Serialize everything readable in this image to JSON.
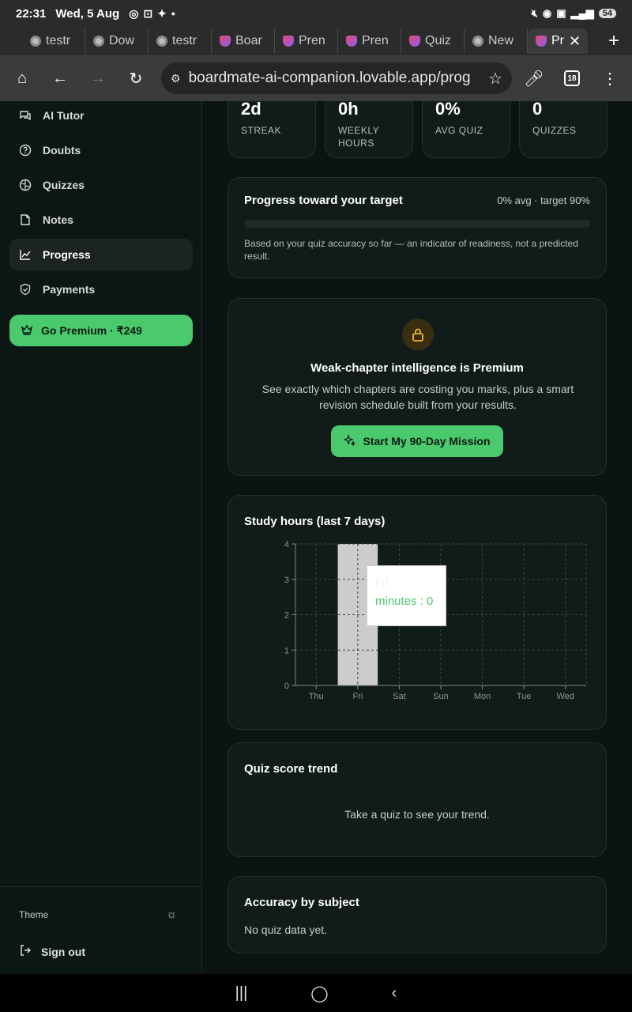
{
  "status": {
    "time": "22:31",
    "date": "Wed, 5 Aug",
    "battery": "54"
  },
  "tabs": [
    {
      "label": "testr",
      "icon": "chrome"
    },
    {
      "label": "Dow",
      "icon": "chrome"
    },
    {
      "label": "testr",
      "icon": "chrome"
    },
    {
      "label": "Boar",
      "icon": "lovable"
    },
    {
      "label": "Pren",
      "icon": "lovable"
    },
    {
      "label": "Pren",
      "icon": "lovable"
    },
    {
      "label": "Quiz",
      "icon": "lovable"
    },
    {
      "label": "New",
      "icon": "chrome"
    },
    {
      "label": "Pr",
      "icon": "lovable",
      "active": true
    }
  ],
  "browser": {
    "url": "boardmate-ai-companion.lovable.app/prog",
    "tab_count": "18"
  },
  "sidebar": {
    "items": [
      {
        "label": "AI Tutor",
        "icon": "chat-icon"
      },
      {
        "label": "Doubts",
        "icon": "help-circle-icon"
      },
      {
        "label": "Quizzes",
        "icon": "brain-icon"
      },
      {
        "label": "Notes",
        "icon": "note-icon"
      },
      {
        "label": "Progress",
        "icon": "chart-line-icon",
        "active": true
      },
      {
        "label": "Payments",
        "icon": "shield-icon"
      }
    ],
    "premium": "Go Premium · ₹249",
    "theme": "Theme",
    "signout": "Sign out"
  },
  "stats": [
    {
      "value": "2d",
      "label": "STREAK"
    },
    {
      "value": "0h",
      "label": "WEEKLY HOURS"
    },
    {
      "value": "0%",
      "label": "AVG QUIZ"
    },
    {
      "value": "0",
      "label": "QUIZZES"
    }
  ],
  "progress": {
    "title": "Progress toward your target",
    "meta": "0% avg · target 90%",
    "value": 0,
    "note": "Based on your quiz accuracy so far — an indicator of readiness, not a predicted result."
  },
  "premium_card": {
    "title": "Weak-chapter intelligence is Premium",
    "desc": "See exactly which chapters are costing you marks, plus a smart revision schedule built from your results.",
    "button": "Start My 90-Day Mission"
  },
  "study_hours": {
    "title": "Study hours (last 7 days)"
  },
  "chart_data": {
    "type": "bar",
    "title": "Study hours (last 7 days)",
    "categories": [
      "Thu",
      "Fri",
      "Sat",
      "Sun",
      "Mon",
      "Tue",
      "Wed"
    ],
    "values": [
      0,
      0,
      0,
      0,
      0,
      0,
      0
    ],
    "yticks": [
      "0",
      "1",
      "2",
      "3",
      "4"
    ],
    "ylim": [
      0,
      4
    ],
    "grid": true,
    "highlight_category": "Fri",
    "tooltip": {
      "label": "Fri",
      "text": "minutes : 0"
    },
    "colors": {
      "bar": "#4bc96d",
      "hover": "#cccccc",
      "tooltip_value": "#4bc96d"
    }
  },
  "quiz_trend": {
    "title": "Quiz score trend",
    "empty": "Take a quiz to see your trend."
  },
  "accuracy": {
    "title": "Accuracy by subject",
    "empty": "No quiz data yet."
  },
  "colors": {
    "accent": "#4bc96d",
    "bg": "#0b1412",
    "card": "#111c1a"
  }
}
